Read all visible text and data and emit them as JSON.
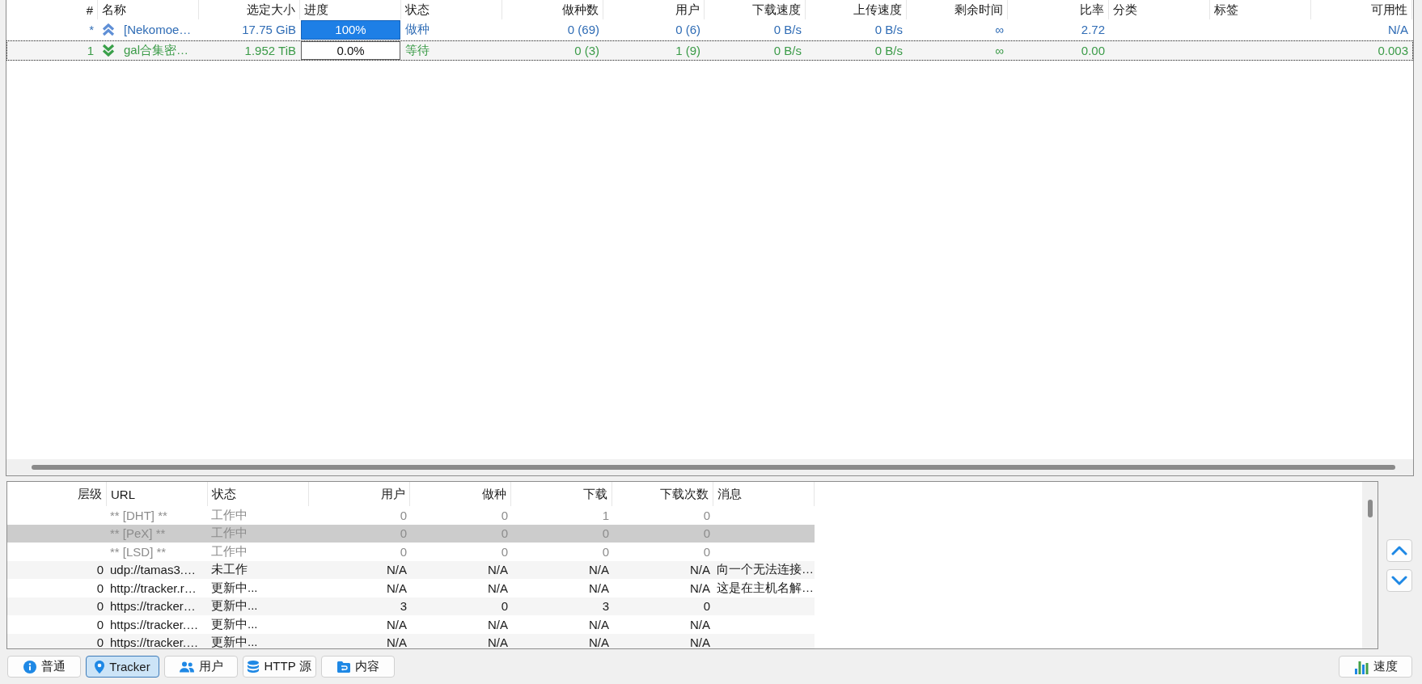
{
  "torrents": {
    "columns": [
      "#",
      "名称",
      "选定大小",
      "进度",
      "状态",
      "做种数",
      "用户",
      "下载速度",
      "上传速度",
      "剩余时间",
      "比率",
      "分类",
      "标签",
      "可用性"
    ],
    "rows": [
      {
        "number": "*",
        "kind": "seeding",
        "name": "[Nekomoe…",
        "size": "17.75 GiB",
        "progress": {
          "level": 1,
          "text": "100%"
        },
        "status": "做种",
        "seeds": "0 (69)",
        "peers": "0 (6)",
        "download_speed": "0 B/s",
        "upload_speed": "0 B/s",
        "eta": "∞",
        "ratio": "2.72",
        "availability": "N/A",
        "focused": false
      },
      {
        "number": "1",
        "kind": "queued",
        "name": "gal合集密…",
        "size": "1.952 TiB",
        "progress": {
          "level": 0,
          "text": "0.0%"
        },
        "status": "等待",
        "seeds": "0 (3)",
        "peers": "1 (9)",
        "download_speed": "0 B/s",
        "upload_speed": "0 B/s",
        "eta": "∞",
        "ratio": "0.00",
        "availability": "0.003",
        "focused": true
      }
    ]
  },
  "trackers": {
    "columns": [
      "层级",
      "URL",
      "状态",
      "用户",
      "做种",
      "下载",
      "下载次数",
      "消息"
    ],
    "rows": [
      {
        "kind": "builtin",
        "url": "** [DHT] **",
        "status": "工作中",
        "peers": "0",
        "seeds": "0",
        "leeches": "1",
        "downloaded": "0",
        "selected": false
      },
      {
        "kind": "builtin",
        "url": "** [PeX] **",
        "status": "工作中",
        "peers": "0",
        "seeds": "0",
        "leeches": "0",
        "downloaded": "0",
        "selected": true
      },
      {
        "kind": "builtin",
        "url": "** [LSD] **",
        "status": "工作中",
        "peers": "0",
        "seeds": "0",
        "leeches": "0",
        "downloaded": "0",
        "selected": false
      },
      {
        "kind": "tracker",
        "tier": "0",
        "url": "udp://tamas3.…",
        "status": "未工作",
        "peers": "N/A",
        "seeds": "N/A",
        "leeches": "N/A",
        "downloaded": "N/A",
        "message": "向一个无法连接…",
        "selected": false
      },
      {
        "kind": "tracker",
        "tier": "0",
        "url": "http://tracker.r…",
        "status": "更新中...",
        "peers": "N/A",
        "seeds": "N/A",
        "leeches": "N/A",
        "downloaded": "N/A",
        "message": "这是在主机名解…",
        "selected": false
      },
      {
        "kind": "tracker",
        "tier": "0",
        "url": "https://tracker…",
        "status": "更新中...",
        "peers": "3",
        "seeds": "0",
        "leeches": "3",
        "downloaded": "0",
        "selected": false
      },
      {
        "kind": "tracker",
        "tier": "0",
        "url": "https://tracker.…",
        "status": "更新中...",
        "peers": "N/A",
        "seeds": "N/A",
        "leeches": "N/A",
        "downloaded": "N/A",
        "selected": false
      },
      {
        "kind": "tracker",
        "tier": "0",
        "url": "https://tracker.…",
        "status": "更新中...",
        "peers": "N/A",
        "seeds": "N/A",
        "leeches": "N/A",
        "downloaded": "N/A",
        "selected": false
      }
    ]
  },
  "tabs": [
    {
      "label": "普通",
      "selected": false
    },
    {
      "label": "Tracker",
      "selected": true
    },
    {
      "label": "用户",
      "selected": false
    },
    {
      "label": "HTTP 源",
      "selected": false
    },
    {
      "label": "内容",
      "selected": false
    }
  ],
  "speed_button": {
    "label": "速度"
  }
}
